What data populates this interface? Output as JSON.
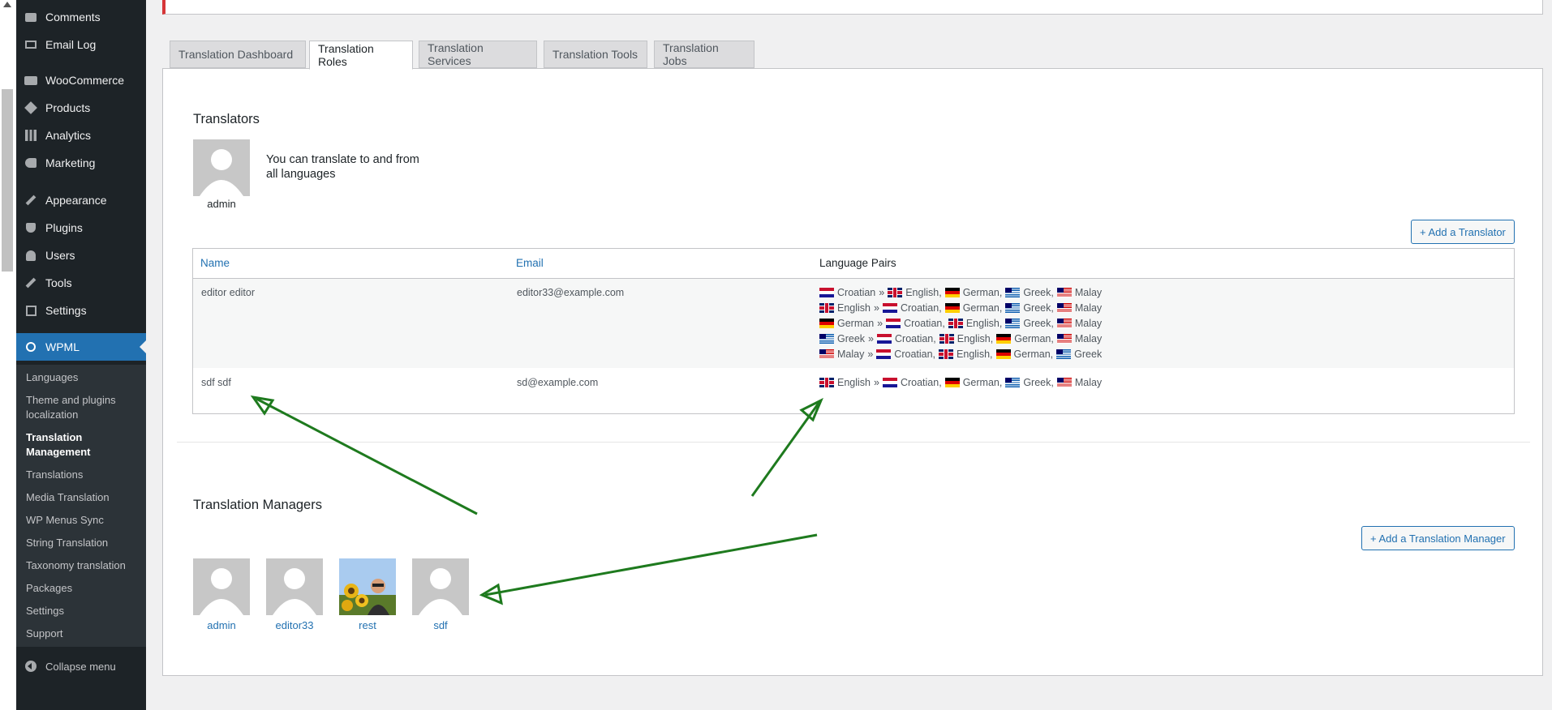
{
  "sidebar": {
    "items": [
      {
        "label": "Comments",
        "icon": "comment-icon"
      },
      {
        "label": "Email Log",
        "icon": "email-icon"
      },
      {
        "label": "WooCommerce",
        "icon": "woocommerce-icon"
      },
      {
        "label": "Products",
        "icon": "products-icon"
      },
      {
        "label": "Analytics",
        "icon": "analytics-icon"
      },
      {
        "label": "Marketing",
        "icon": "marketing-icon"
      },
      {
        "label": "Appearance",
        "icon": "appearance-icon"
      },
      {
        "label": "Plugins",
        "icon": "plugins-icon"
      },
      {
        "label": "Users",
        "icon": "users-icon"
      },
      {
        "label": "Tools",
        "icon": "tools-icon"
      },
      {
        "label": "Settings",
        "icon": "settings-icon"
      },
      {
        "label": "WPML",
        "icon": "wpml-icon"
      }
    ],
    "submenu": [
      "Languages",
      "Theme and plugins localization",
      "Translation Management",
      "Translations",
      "Media Translation",
      "WP Menus Sync",
      "String Translation",
      "Taxonomy translation",
      "Packages",
      "Settings",
      "Support"
    ],
    "collapse_label": "Collapse menu"
  },
  "tabs": [
    "Translation Dashboard",
    "Translation Roles",
    "Translation Services",
    "Translation Tools",
    "Translation Jobs"
  ],
  "translators": {
    "title": "Translators",
    "current_user": "admin",
    "message": "You can translate to and from all languages",
    "add_button": "+ Add a Translator",
    "columns": [
      "Name",
      "Email",
      "Language Pairs"
    ],
    "rows": [
      {
        "name": "editor editor",
        "email": "editor33@example.com",
        "pairs": [
          {
            "from": "Croatian",
            "to": [
              "English",
              "German",
              "Greek",
              "Malay"
            ]
          },
          {
            "from": "English",
            "to": [
              "Croatian",
              "German",
              "Greek",
              "Malay"
            ]
          },
          {
            "from": "German",
            "to": [
              "Croatian",
              "English",
              "Greek",
              "Malay"
            ]
          },
          {
            "from": "Greek",
            "to": [
              "Croatian",
              "English",
              "German",
              "Malay"
            ]
          },
          {
            "from": "Malay",
            "to": [
              "Croatian",
              "English",
              "German",
              "Greek"
            ]
          }
        ]
      },
      {
        "name": "sdf sdf",
        "email": "sd@example.com",
        "pairs": [
          {
            "from": "English",
            "to": [
              "Croatian",
              "German",
              "Greek",
              "Malay"
            ]
          }
        ]
      }
    ]
  },
  "managers": {
    "title": "Translation Managers",
    "add_button": "+ Add a Translation Manager",
    "users": [
      "admin",
      "editor33",
      "rest",
      "sdf"
    ]
  },
  "colors": {
    "accent": "#2271b1",
    "sidebar": "#1d2327",
    "annotation": "#1e7a1e"
  }
}
